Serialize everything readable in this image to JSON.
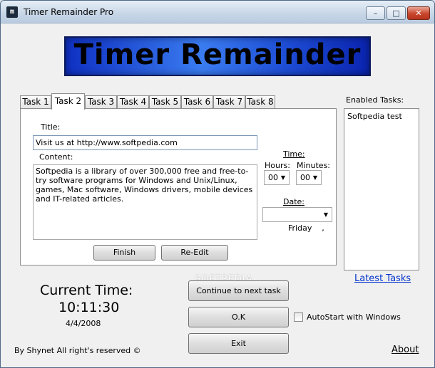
{
  "window": {
    "title": "Timer Remainder Pro",
    "icon_glyph": "m",
    "controls": {
      "minimize": "–",
      "maximize": "□",
      "close": "✕"
    }
  },
  "banner": {
    "text": "Timer Remainder"
  },
  "tabs": [
    {
      "label": "Task 1",
      "active": false
    },
    {
      "label": "Task 2",
      "active": true
    },
    {
      "label": "Task 3",
      "active": false
    },
    {
      "label": "Task 4",
      "active": false
    },
    {
      "label": "Task 5",
      "active": false
    },
    {
      "label": "Task 6",
      "active": false
    },
    {
      "label": "Task 7",
      "active": false
    },
    {
      "label": "Task 8",
      "active": false
    }
  ],
  "task": {
    "title_label": "Title:",
    "title_value": "Visit us at http://www.softpedia.com",
    "content_label": "Content:",
    "content_value": "Softpedia is a library of over 300,000 free and free-to-try software programs for Windows and Unix/Linux, games, Mac software, Windows drivers, mobile devices and IT-related articles.",
    "time_label": "Time:",
    "hours_label": "Hours:",
    "hours_value": "00",
    "minutes_label": "Minutes:",
    "minutes_value": "00",
    "date_label": "Date:",
    "date_value": "Friday    ,",
    "finish_label": "Finish",
    "reedit_label": "Re-Edit"
  },
  "enabled": {
    "label": "Enabled Tasks:",
    "items": [
      "Softpedia test"
    ]
  },
  "latest_tasks_link": "Latest Tasks",
  "clock": {
    "label": "Current Time:",
    "time": "10:11:30",
    "date": "4/4/2008"
  },
  "buttons": {
    "continue": "Continue to next task",
    "ok": "O.K",
    "exit": "Exit"
  },
  "autostart": {
    "label": "AutoStart with Windows",
    "checked": false
  },
  "watermark": "SOFTPEDIA",
  "footer": {
    "copyright": "By Shynet All right's reserved ©",
    "about": "About"
  },
  "colors": {
    "accent": "#0033cc",
    "banner": "#2a5fe0"
  },
  "icons": {
    "dropdown": "chevron-down-icon"
  }
}
